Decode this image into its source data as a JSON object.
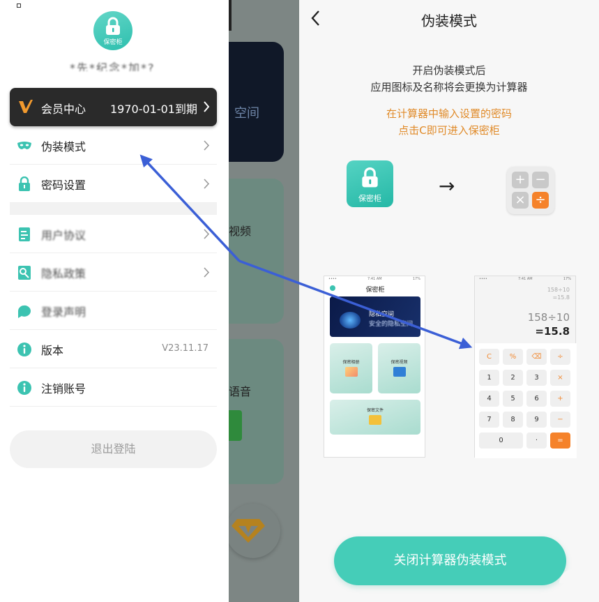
{
  "left_panel": {
    "app_logo_label": "保密柜",
    "user_name": "*先*纪念*加*?",
    "vip": {
      "label": "会员中心",
      "expire": "1970-01-01到期"
    },
    "menu": [
      {
        "key": "disguise",
        "label": "伪装模式",
        "icon": "mask-icon"
      },
      {
        "key": "password",
        "label": "密码设置",
        "icon": "lock-icon"
      },
      {
        "key": "user_agreement",
        "label": "用户协议",
        "icon": "document-icon"
      },
      {
        "key": "privacy",
        "label": "隐私政策",
        "icon": "privacy-icon"
      },
      {
        "key": "disclaimer",
        "label": "登录声明",
        "icon": "chat-icon"
      },
      {
        "key": "version",
        "label": "版本",
        "value": "V23.11.17",
        "icon": "info-icon"
      },
      {
        "key": "cancel_account",
        "label": "注销账号",
        "icon": "info-icon"
      }
    ],
    "logout_label": "退出登陆"
  },
  "background_behind_drawer": {
    "banner_text": "空间",
    "card2_text": "视频",
    "card3_text": "语音"
  },
  "right_panel": {
    "title": "伪装模式",
    "desc_line1": "开启伪装模式后",
    "desc_line2": "应用图标及名称将会更换为计算器",
    "hint_line1": "在计算器中输入设置的密码",
    "hint_line2": "点击C即可进入保密柜",
    "app_icon_label": "保密柜",
    "transition_arrow": "→",
    "calculator_icon_keys": [
      "+",
      "−",
      "×",
      "÷"
    ],
    "mock_left": {
      "status_left": "••••",
      "status_time": "7:41 AM",
      "status_right": "17%",
      "title": "保密柜",
      "banner_line1": "隐私空间",
      "banner_line2": "安全的隐私空间",
      "tiles": [
        "保密相册",
        "保密视频",
        "保密文件"
      ]
    },
    "mock_right": {
      "status_left": "••••",
      "status_time": "7:41 AM",
      "status_right": "17%",
      "history1": "158÷10",
      "history2": "=15.8",
      "expression": "158÷10",
      "result": "=15.8",
      "keys": [
        [
          "C",
          "%",
          "⌫",
          "÷"
        ],
        [
          "1",
          "2",
          "3",
          "×"
        ],
        [
          "4",
          "5",
          "6",
          "+"
        ],
        [
          "7",
          "8",
          "9",
          "−"
        ],
        [
          "0",
          "·",
          "="
        ]
      ]
    },
    "close_button_label": "关闭计算器伪装模式"
  },
  "colors": {
    "accent": "#45cdb8",
    "hint": "#e08a28",
    "vip_bar": "#2a2a2a",
    "vip_icon": "#f29a2e",
    "annotation_arrow": "#3b5fd6",
    "calc_orange": "#f5822a"
  }
}
